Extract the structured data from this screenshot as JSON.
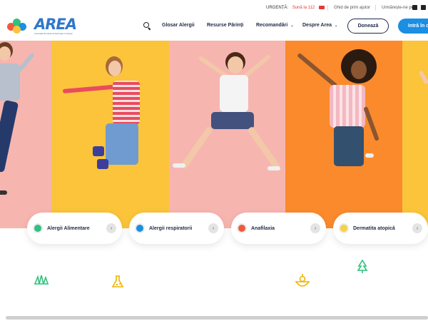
{
  "topbar": {
    "urgent_label": "URGENȚĂ:",
    "urgent_phone": "Sună la 112",
    "guide_link": "Ghid de prim ajutor",
    "follow_label": "Urmărește-ne pe"
  },
  "logo": {
    "word": "AREA",
    "subtitle": "Asociația Română de Educație în Alergii"
  },
  "nav": {
    "items": [
      {
        "label": "Glosar Alergii",
        "dropdown": false
      },
      {
        "label": "Resurse Părinți",
        "dropdown": false
      },
      {
        "label": "Recomandări",
        "dropdown": true
      },
      {
        "label": "Despre Area",
        "dropdown": true
      }
    ],
    "donate": "Donează",
    "login": "Intră în cont",
    "chevron": "⌄"
  },
  "categories": [
    {
      "label": "Alergii Alimentare",
      "color": "#2ec27e"
    },
    {
      "label": "Alergii respiratorii",
      "color": "#1a8fe3"
    },
    {
      "label": "Anafilaxia",
      "color": "#f05a3c"
    },
    {
      "label": "Dermatita atopică",
      "color": "#f7d23a"
    }
  ],
  "arrow_glyph": "›",
  "colors": {
    "brand_blue": "#2f78c9",
    "button_blue": "#1a8fe3",
    "panel_pink": "#f7b5b0",
    "panel_yellow": "#fbc43a",
    "panel_orange": "#fb8a2d"
  },
  "icons": [
    "search-icon",
    "warning-icon",
    "youtube-icon",
    "facebook-icon",
    "arrow-right-icon",
    "grass-icon",
    "flask-icon",
    "food-bowl-icon",
    "tree-icon"
  ]
}
